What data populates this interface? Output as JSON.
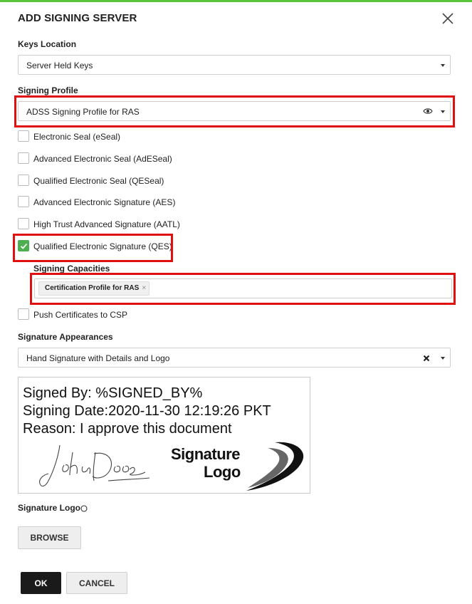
{
  "dialog": {
    "title": "ADD SIGNING SERVER",
    "accent_color": "#5ac43b"
  },
  "keys_location": {
    "label": "Keys Location",
    "value": "Server Held Keys"
  },
  "signing_profile": {
    "label": "Signing Profile",
    "value": "ADSS Signing Profile for RAS"
  },
  "checkboxes": [
    {
      "label": "Electronic Seal (eSeal)",
      "checked": false
    },
    {
      "label": "Advanced Electronic Seal (AdESeal)",
      "checked": false
    },
    {
      "label": "Qualified Electronic Seal (QESeal)",
      "checked": false
    },
    {
      "label": "Advanced Electronic Signature (AES)",
      "checked": false
    },
    {
      "label": "High Trust Advanced Signature (AATL)",
      "checked": false
    },
    {
      "label": "Qualified Electronic Signature (QES)",
      "checked": true
    }
  ],
  "signing_capacities": {
    "label": "Signing Capacities",
    "chip": "Certification Profile for RAS"
  },
  "push_certificates": {
    "label": "Push Certificates to CSP",
    "checked": false
  },
  "signature_appearances": {
    "label": "Signature Appearances",
    "value": "Hand Signature with Details and Logo"
  },
  "preview": {
    "line1": "Signed By: %SIGNED_BY%",
    "line2": "Signing Date:2020-11-30 12:19:26 PKT",
    "line3": "Reason: I approve this document",
    "logo_text": "Signature Logo"
  },
  "signature_logo": {
    "label": "Signature Logo",
    "browse": "BROWSE"
  },
  "footer": {
    "ok": "OK",
    "cancel": "CANCEL"
  },
  "highlight_color": "#e01010"
}
